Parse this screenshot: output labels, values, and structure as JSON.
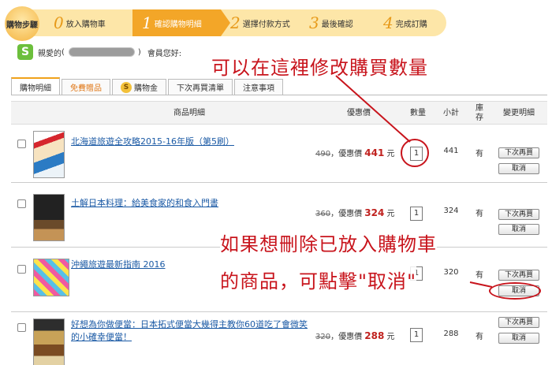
{
  "steps": {
    "lead": "購物步驟",
    "items": [
      {
        "num": "0",
        "label": "放入購物車"
      },
      {
        "num": "1",
        "label": "確認購物明細"
      },
      {
        "num": "2",
        "label": "選擇付款方式"
      },
      {
        "num": "3",
        "label": "最後確認"
      },
      {
        "num": "4",
        "label": "完成訂購"
      }
    ],
    "active_index": 1
  },
  "greeting": {
    "badge": "S",
    "prefix": "親愛的",
    "open_paren": "(",
    "close_paren": ")",
    "suffix": "會員您好:"
  },
  "tabs": [
    {
      "label": "購物明細"
    },
    {
      "label": "免費贈品"
    },
    {
      "label": "購物金",
      "icon": "S"
    },
    {
      "label": "下次再買清單"
    },
    {
      "label": "注意事項"
    }
  ],
  "table": {
    "headers": {
      "item": "商品明細",
      "price": "優惠價",
      "qty": "數量",
      "subtotal": "小計",
      "stock": "庫存",
      "change": "變更明細"
    },
    "price_separator": "，優惠價",
    "currency": "元",
    "buy_later_label": "下次再買",
    "cancel_label": "取消",
    "rows": [
      {
        "title": "北海道旅遊全攻略2015-16年版（第5刷）",
        "orig": "490",
        "price": "441",
        "qty": "1",
        "subtotal": "441",
        "stock": "有"
      },
      {
        "title": "土解日本料理：給美食家的和食入門書",
        "orig": "360",
        "price": "324",
        "qty": "1",
        "subtotal": "324",
        "stock": "有"
      },
      {
        "title": "沖繩旅遊最新指南 2016",
        "orig": "",
        "price": "",
        "qty": "1",
        "subtotal": "320",
        "stock": "有"
      },
      {
        "title": "好想為你做便當：日本拓式便當大幾得主教你60道吃了會微笑的小確幸便當！",
        "orig": "320",
        "price": "288",
        "qty": "1",
        "subtotal": "288",
        "stock": "有"
      }
    ]
  },
  "annotations": {
    "qty_note": "可以在這裡修改購買數量",
    "delete_note_1": "如果想刪除已放入購物車",
    "delete_note_2": "的商品，可點擊\"取消\"",
    "color": "#c8141c"
  }
}
